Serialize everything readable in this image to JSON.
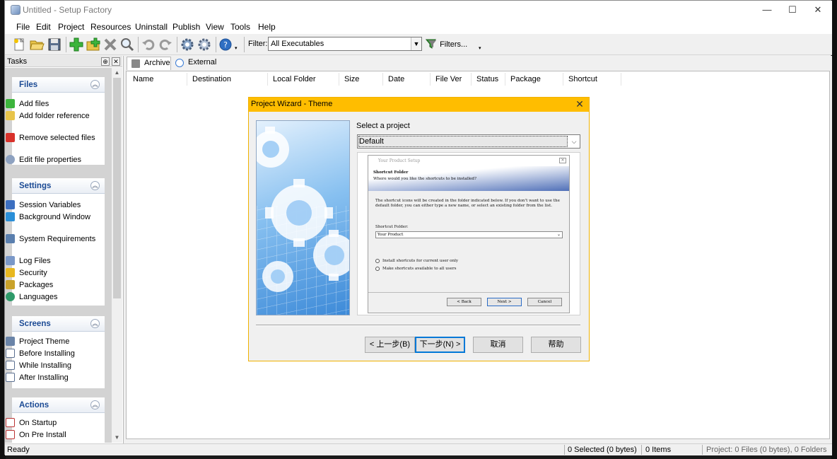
{
  "window": {
    "title": "Untitled - Setup Factory",
    "controls": {
      "minimize": "—",
      "maximize": "☐",
      "close": "✕"
    }
  },
  "menu": [
    "File",
    "Edit",
    "Project",
    "Resources",
    "Uninstall",
    "Publish",
    "View",
    "Tools",
    "Help"
  ],
  "toolbar": {
    "filter_label": "Filter:",
    "filter_value": "All Executables",
    "filters_button": "Filters..."
  },
  "tasks": {
    "title": "Tasks",
    "groups": [
      {
        "title": "Files",
        "items": [
          "Add files",
          "Add folder reference",
          "Remove selected files",
          "Edit file properties"
        ]
      },
      {
        "title": "Settings",
        "items": [
          "Session Variables",
          "Background Window",
          "System Requirements",
          "Log Files",
          "Security",
          "Packages",
          "Languages"
        ]
      },
      {
        "title": "Screens",
        "items": [
          "Project Theme",
          "Before Installing",
          "While Installing",
          "After Installing"
        ]
      },
      {
        "title": "Actions",
        "items": [
          "On Startup",
          "On Pre Install"
        ]
      }
    ]
  },
  "tabs": [
    "Archive",
    "External"
  ],
  "columns": [
    "Name",
    "Destination",
    "Local Folder",
    "Size",
    "Date",
    "File Ver",
    "Status",
    "Package",
    "Shortcut"
  ],
  "status": {
    "left": "Ready",
    "selected": "0 Selected (0 bytes)",
    "items": "0 Items",
    "project": "Project: 0 Files (0 bytes), 0 Folders"
  },
  "dialog": {
    "title": "Project Wizard - Theme",
    "select_label": "Select a project",
    "project_value": "Default",
    "preview": {
      "window_title": "Your Product Setup",
      "heading": "Shortcut Folder",
      "subheading": "Where would you like the shortcuts to be installed?",
      "body": "The shortcut icons will be created in the folder indicated below. If you don't want to use the default folder, you can either type a new name, or select an existing folder from the list.",
      "field_label": "Shortcut Folder:",
      "field_value": "Your Product",
      "radio1": "Install shortcuts for current user only",
      "radio2": "Make shortcuts available to all users",
      "back": "< Back",
      "next": "Next >",
      "cancel": "Cancel"
    },
    "buttons": {
      "back": "< 上一步(B)",
      "next": "下一步(N) >",
      "cancel": "取消",
      "help": "帮助"
    }
  },
  "colors": {
    "dialog_title": "#ffbd00",
    "group_title": "#1b4a94",
    "window_bg": "#f0f0f0"
  }
}
